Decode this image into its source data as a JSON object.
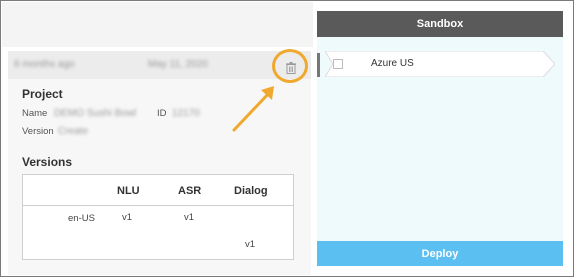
{
  "project": {
    "card_date_left": "6 months ago",
    "card_date_right": "May 11, 2020",
    "section_title": "Project",
    "name_label": "Name",
    "name_value": "DEMO Sushi Bowl",
    "id_label": "ID",
    "id_value": "12170",
    "version_label": "Version",
    "version_value": "Create"
  },
  "versions": {
    "section_title": "Versions",
    "headers": [
      "NLU",
      "ASR",
      "Dialog"
    ],
    "rows": [
      {
        "locale": "en-US",
        "nlu": "v1",
        "asr": "v1",
        "dialog": ""
      },
      {
        "locale": "",
        "nlu": "",
        "asr": "",
        "dialog": "v1"
      }
    ]
  },
  "sandbox": {
    "title": "Sandbox",
    "environment": "Azure US",
    "deploy_label": "Deploy"
  },
  "icons": {
    "delete": "trash-icon",
    "annotation": "arrow-annotation",
    "checkbox": "checkbox-icon"
  },
  "colors": {
    "annotation_orange": "#f0a92e",
    "sandbox_header": "#5a5a5a",
    "deploy_blue": "#5bbff2",
    "sandbox_bg": "#effafc"
  }
}
